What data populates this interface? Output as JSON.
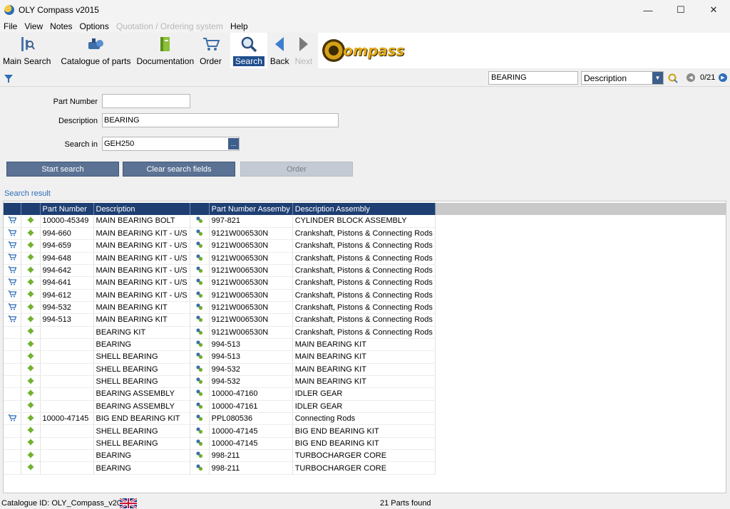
{
  "window": {
    "title": "OLY Compass v2015"
  },
  "menu": [
    "File",
    "View",
    "Notes",
    "Options",
    "Quotation / Ordering system",
    "Help"
  ],
  "toolbar": {
    "main_search": "Main Search",
    "catalogue": "Catalogue of parts",
    "documentation": "Documentation",
    "order": "Order",
    "search": "Search",
    "back": "Back",
    "next": "Next",
    "logo_text": "ompass"
  },
  "strip": {
    "search_value": "BEARING",
    "select_value": "Description",
    "count": "0/21"
  },
  "form": {
    "part_number_label": "Part Number",
    "part_number_value": "",
    "description_label": "Description",
    "description_value": "BEARING",
    "search_in_label": "Search in",
    "search_in_value": "GEH250",
    "browse_label": "..."
  },
  "buttons": {
    "start_search": "Start search",
    "clear_fields": "Clear search fields",
    "order": "Order"
  },
  "results": {
    "title": "Search result",
    "columns": [
      "",
      "",
      "Part Number",
      "Description",
      "",
      "Part Number Assemby",
      "Description Assembly"
    ],
    "rows": [
      {
        "cart": true,
        "link": "gear",
        "part": "10000-45349",
        "desc": "MAIN BEARING BOLT",
        "pna": "997-821",
        "da": "CYLINDER BLOCK ASSEMBLY"
      },
      {
        "cart": true,
        "link": "gear",
        "part": "994-660",
        "desc": "MAIN BEARING KIT - U/S",
        "pna": "9121W006530N",
        "da": "Crankshaft, Pistons & Connecting Rods"
      },
      {
        "cart": true,
        "link": "gear",
        "part": "994-659",
        "desc": "MAIN BEARING KIT - U/S",
        "pna": "9121W006530N",
        "da": "Crankshaft, Pistons & Connecting Rods"
      },
      {
        "cart": true,
        "link": "gear",
        "part": "994-648",
        "desc": "MAIN BEARING KIT - U/S",
        "pna": "9121W006530N",
        "da": "Crankshaft, Pistons & Connecting Rods"
      },
      {
        "cart": true,
        "link": "gear",
        "part": "994-642",
        "desc": "MAIN BEARING KIT - U/S",
        "pna": "9121W006530N",
        "da": "Crankshaft, Pistons & Connecting Rods"
      },
      {
        "cart": true,
        "link": "gear",
        "part": "994-641",
        "desc": "MAIN BEARING KIT - U/S",
        "pna": "9121W006530N",
        "da": "Crankshaft, Pistons & Connecting Rods"
      },
      {
        "cart": true,
        "link": "gear",
        "part": "994-612",
        "desc": "MAIN BEARING KIT - U/S",
        "pna": "9121W006530N",
        "da": "Crankshaft, Pistons & Connecting Rods"
      },
      {
        "cart": true,
        "link": "gears",
        "part": "994-532",
        "desc": "MAIN BEARING KIT",
        "pna": "9121W006530N",
        "da": "Crankshaft, Pistons & Connecting Rods"
      },
      {
        "cart": true,
        "link": "gears",
        "part": "994-513",
        "desc": "MAIN BEARING KIT",
        "pna": "9121W006530N",
        "da": "Crankshaft, Pistons & Connecting Rods"
      },
      {
        "cart": false,
        "link": "gear",
        "part": "",
        "desc": "BEARING KIT",
        "pna": "9121W006530N",
        "da": "Crankshaft, Pistons & Connecting Rods"
      },
      {
        "cart": false,
        "link": "gear",
        "part": "",
        "desc": "BEARING",
        "pna": "994-513",
        "da": "MAIN BEARING KIT"
      },
      {
        "cart": false,
        "link": "gear",
        "part": "",
        "desc": "SHELL BEARING",
        "pna": "994-513",
        "da": "MAIN BEARING KIT"
      },
      {
        "cart": false,
        "link": "gear",
        "part": "",
        "desc": "SHELL BEARING",
        "pna": "994-532",
        "da": "MAIN BEARING KIT"
      },
      {
        "cart": false,
        "link": "gear",
        "part": "",
        "desc": "SHELL BEARING",
        "pna": "994-532",
        "da": "MAIN BEARING KIT"
      },
      {
        "cart": false,
        "link": "gear",
        "part": "",
        "desc": "BEARING ASSEMBLY",
        "pna": "10000-47160",
        "da": "IDLER GEAR"
      },
      {
        "cart": false,
        "link": "gear",
        "part": "",
        "desc": "BEARING ASSEMBLY",
        "pna": "10000-47161",
        "da": "IDLER GEAR"
      },
      {
        "cart": true,
        "link": "gears",
        "part": "10000-47145",
        "desc": "BIG END BEARING KIT",
        "pna": "PPL080536",
        "da": "Connecting Rods"
      },
      {
        "cart": false,
        "link": "gear",
        "part": "",
        "desc": "SHELL BEARING",
        "pna": "10000-47145",
        "da": "BIG END BEARING KIT"
      },
      {
        "cart": false,
        "link": "gear",
        "part": "",
        "desc": "SHELL BEARING",
        "pna": "10000-47145",
        "da": "BIG END BEARING KIT"
      },
      {
        "cart": false,
        "link": "gear",
        "part": "",
        "desc": "BEARING",
        "pna": "998-211",
        "da": "TURBOCHARGER CORE"
      },
      {
        "cart": false,
        "link": "gear",
        "part": "",
        "desc": "BEARING",
        "pna": "998-211",
        "da": "TURBOCHARGER CORE"
      }
    ]
  },
  "status": {
    "catalogue_id": "Catalogue ID: OLY_Compass_v2015",
    "parts_found": "21 Parts found"
  },
  "colors": {
    "header_bg": "#1f3f73",
    "button_blue": "#5b7294",
    "link_blue": "#2e6db8"
  },
  "icons": {
    "cart": "cart-icon",
    "gear": "gear-icon",
    "gears": "gears-link-icon",
    "flag": "uk-flag-icon"
  }
}
